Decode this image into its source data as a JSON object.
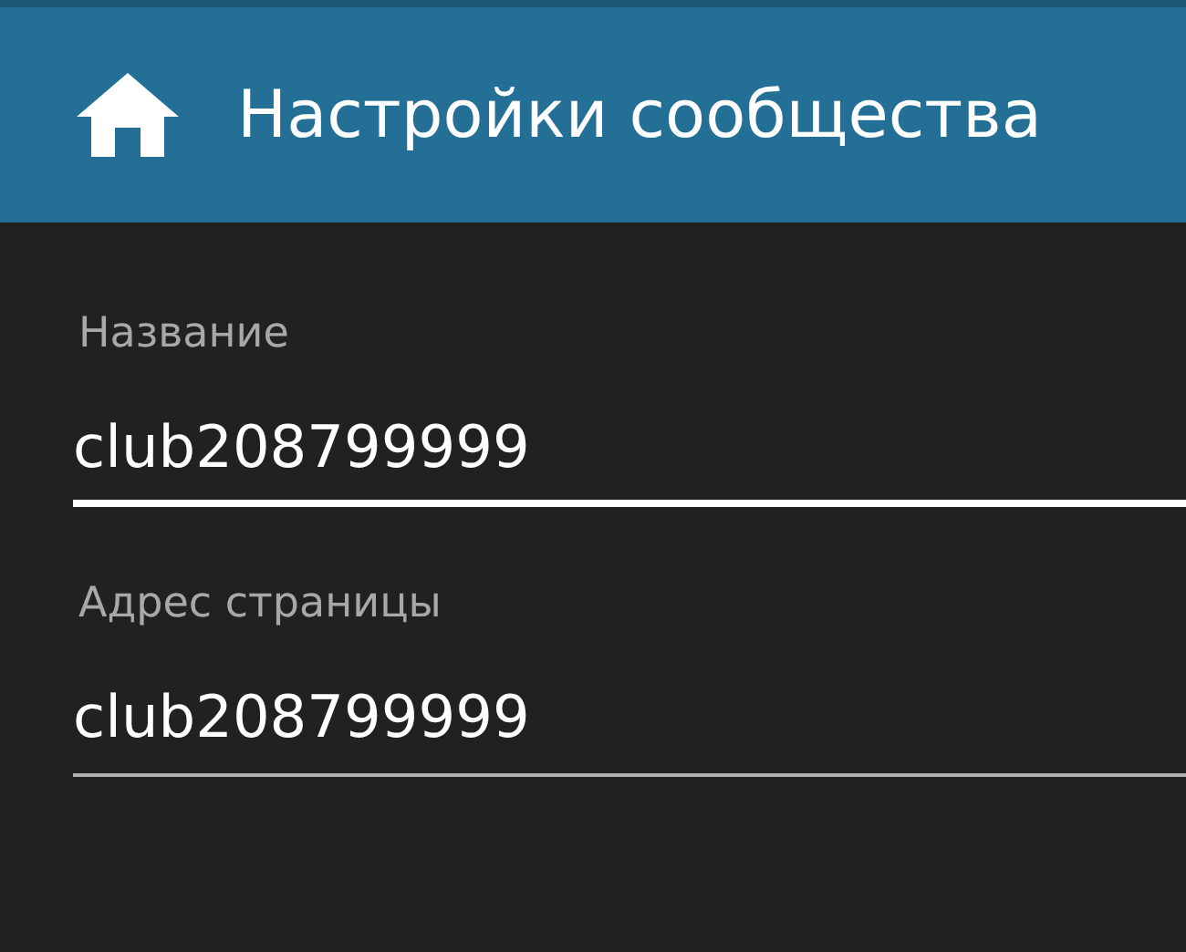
{
  "header": {
    "title": "Настройки сообщества"
  },
  "fields": [
    {
      "label": "Название",
      "value": "club208799999",
      "focused": true
    },
    {
      "label": "Адрес страницы",
      "value": "club208799999",
      "focused": false
    }
  ]
}
